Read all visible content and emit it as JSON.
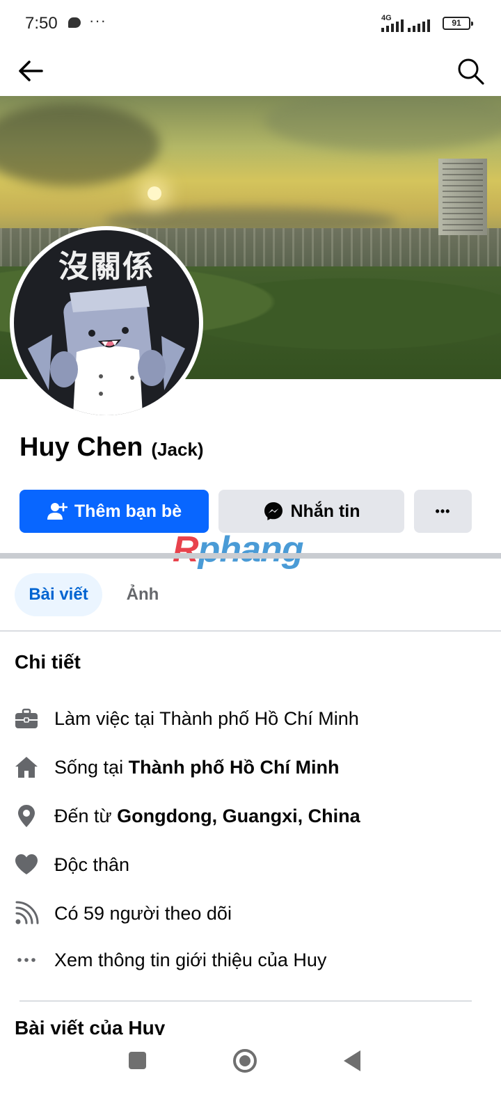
{
  "status_bar": {
    "time": "7:50",
    "network": "4G",
    "battery": "91",
    "icons": [
      "chat-icon",
      "more-dots-icon",
      "signal-icon",
      "battery-icon"
    ]
  },
  "app_bar": {
    "icons": [
      "back-arrow-icon",
      "search-icon"
    ]
  },
  "profile": {
    "avatar_text": "沒關係",
    "name": "Huy Chen",
    "nickname": "(Jack)"
  },
  "actions": {
    "add_friend": "Thêm bạn bè",
    "message": "Nhắn tin",
    "more": "•••"
  },
  "watermark": {
    "letter": "R",
    "rest": "phang"
  },
  "tabs": [
    {
      "label": "Bài viết",
      "selected": true
    },
    {
      "label": "Ảnh",
      "selected": false
    }
  ],
  "details": {
    "title": "Chi tiết",
    "work": "Làm việc tại Thành phố Hồ Chí Minh",
    "lives_prefix": "Sống tại ",
    "lives_city": "Thành phố Hồ Chí Minh",
    "from_prefix": "Đến từ ",
    "from_place": "Gongdong, Guangxi, China",
    "relationship": "Độc thân",
    "followers": "Có 59 người theo dõi",
    "see_about": "Xem thông tin giới thiệu của Huy"
  },
  "posts_section": {
    "title": "Bài viết của Huy"
  },
  "colors": {
    "primary": "#0866ff",
    "secondary_button": "#e4e6eb",
    "selected_tab_bg": "#ebf5ff",
    "selected_tab_text": "#0064d1",
    "icon_gray": "#65676b"
  }
}
